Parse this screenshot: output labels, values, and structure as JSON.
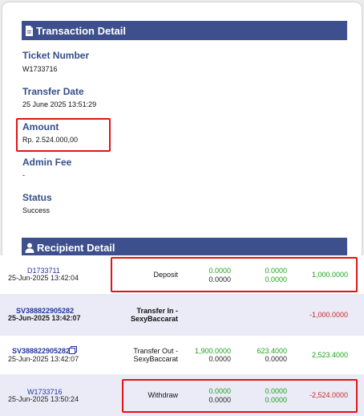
{
  "transaction_detail": {
    "title": "Transaction Detail",
    "fields": [
      {
        "label": "Ticket Number",
        "value": "W1733716"
      },
      {
        "label": "Transfer Date",
        "value": "25 June 2025 13:51:29"
      },
      {
        "label": "Amount",
        "value": "Rp. 2.524.000,00"
      },
      {
        "label": "Admin Fee",
        "value": "-"
      },
      {
        "label": "Status",
        "value": "Success"
      }
    ]
  },
  "recipient_detail": {
    "title": "Recipient Detail"
  },
  "transactions": [
    {
      "ref": "D1733711",
      "time": "25-Jun-2025 13:42:04",
      "type": "Deposit",
      "col1_top": "0.0000",
      "col1_bottom": "0.0000",
      "col2_top": "0.0000",
      "col2_bottom": "0.0000",
      "amount": "1,000.0000"
    },
    {
      "ref": "SV388822905282",
      "time": "25-Jun-2025 13:42:07",
      "type_line1": "Transfer In -",
      "type_line2": "SexyBaccarat",
      "amount": "-1,000.0000"
    },
    {
      "ref": "SV388822905282",
      "time": "25-Jun-2025 13:42:07",
      "type_line1": "Transfer Out -",
      "type_line2": "SexyBaccarat",
      "col1_top": "1,900.0000",
      "col1_bottom": "0.0000",
      "col2_top": "623.4000",
      "col2_bottom": "0.0000",
      "amount": "2,523.4000"
    },
    {
      "ref": "W1733716",
      "time": "25-Jun-2025 13:50:24",
      "type": "Withdraw",
      "col1_top": "0.0000",
      "col1_bottom": "0.0000",
      "col2_top": "0.0000",
      "col2_bottom": "0.0000",
      "amount": "-2,524.0000"
    }
  ],
  "colors": {
    "header_bg": "#3d4f8c",
    "label": "#354f8a",
    "highlight": "#e01515",
    "positive": "#1ea11e",
    "negative": "#c62828",
    "link": "#23339c"
  },
  "icons": [
    "document-icon",
    "user-icon",
    "copy-icon"
  ]
}
